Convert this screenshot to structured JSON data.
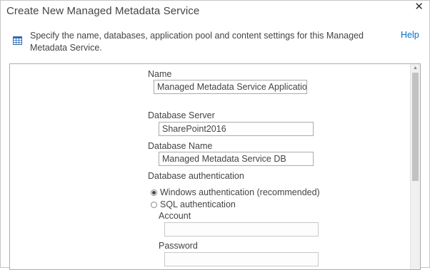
{
  "dialog": {
    "title": "Create New Managed Metadata Service",
    "close_glyph": "✕",
    "description": "Specify the name, databases, application pool and content settings for this Managed Metadata Service.",
    "help_label": "Help",
    "info_icon": "info-icon"
  },
  "form": {
    "name_label": "Name",
    "name_value": "Managed Metadata Service Application",
    "db_server_label": "Database Server",
    "db_server_value": "SharePoint2016",
    "db_name_label": "Database Name",
    "db_name_value": "Managed Metadata Service DB",
    "db_auth_label": "Database authentication",
    "auth_options": [
      {
        "label": "Windows authentication (recommended)",
        "selected": true
      },
      {
        "label": "SQL authentication",
        "selected": false
      }
    ],
    "account_label": "Account",
    "account_value": "",
    "password_label": "Password",
    "password_value": ""
  },
  "scrollbar": {
    "up_glyph": "▲"
  }
}
